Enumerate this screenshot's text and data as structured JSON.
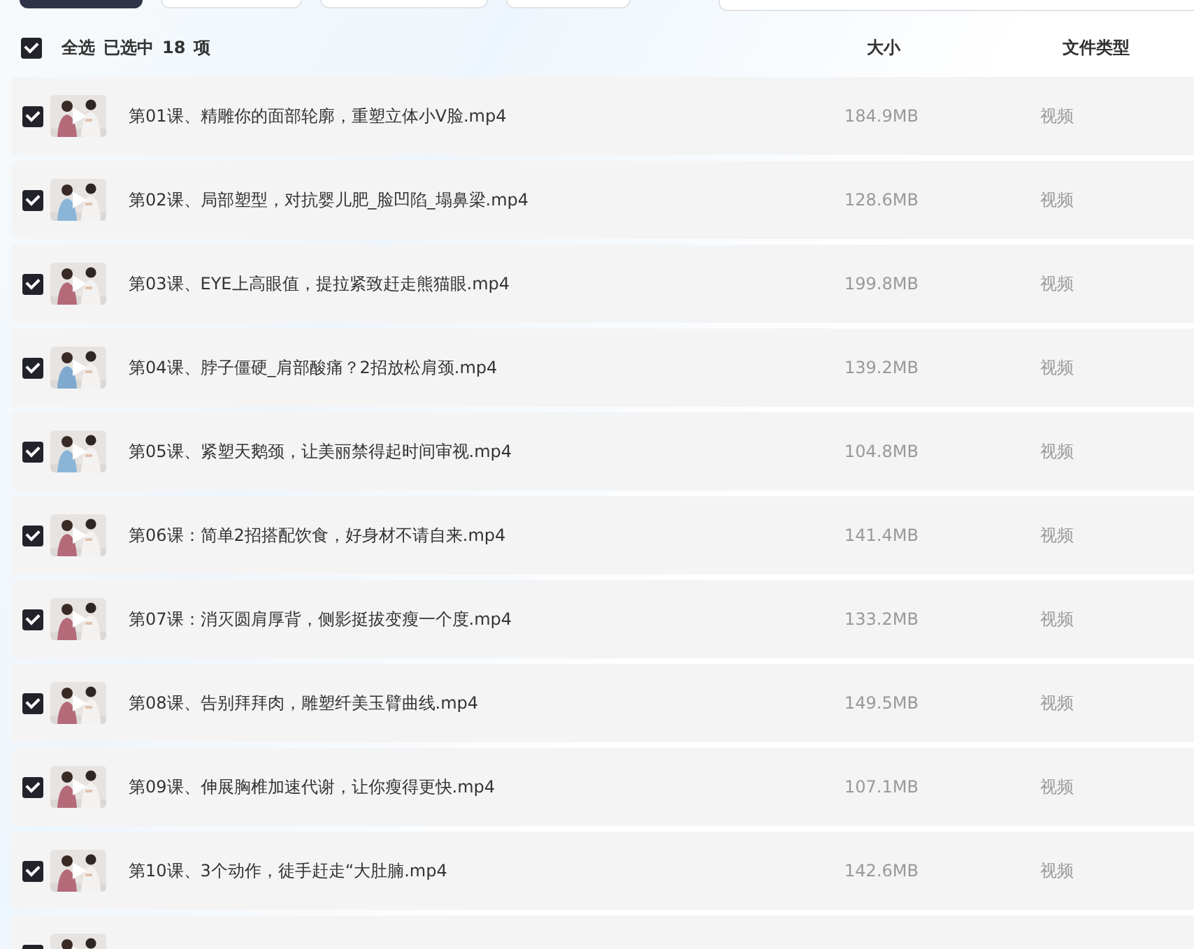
{
  "toolbar": {
    "buttons": [
      {
        "kind": "primary"
      },
      {
        "kind": "plain"
      },
      {
        "kind": "plain"
      },
      {
        "kind": "plain"
      }
    ],
    "search": {
      "kind": "field"
    }
  },
  "header": {
    "select_all": {
      "checked": true,
      "label": "全选"
    },
    "selected_label": "已选中",
    "selected_count": "18",
    "selected_unit": "项",
    "columns": [
      "大小",
      "文件类型"
    ]
  },
  "rows": [
    {
      "checked": true,
      "name": "第01课、精雕你的面部轮廓，重塑立体小V脸.mp4",
      "size": "184.9MB",
      "type": "视频"
    },
    {
      "checked": true,
      "name": "第02课、局部塑型，对抗婴儿肥_脸凹陷_塌鼻梁.mp4",
      "size": "128.6MB",
      "type": "视频"
    },
    {
      "checked": true,
      "name": "第03课、EYE上高眼值，提拉紧致赶走熊猫眼.mp4",
      "size": "199.8MB",
      "type": "视频"
    },
    {
      "checked": true,
      "name": "第04课、脖子僵硬_肩部酸痛？2招放松肩颈.mp4",
      "size": "139.2MB",
      "type": "视频"
    },
    {
      "checked": true,
      "name": "第05课、紧塑天鹅颈，让美丽禁得起时间审视.mp4",
      "size": "104.8MB",
      "type": "视频"
    },
    {
      "checked": true,
      "name": "第06课：简单2招搭配饮食，好身材不请自来.mp4",
      "size": "141.4MB",
      "type": "视频"
    },
    {
      "checked": true,
      "name": "第07课：消灭圆肩厚背，侧影挺拔变瘦一个度.mp4",
      "size": "133.2MB",
      "type": "视频"
    },
    {
      "checked": true,
      "name": "第08课、告别拜拜肉，雕塑纤美玉臂曲线.mp4",
      "size": "149.5MB",
      "type": "视频"
    },
    {
      "checked": true,
      "name": "第09课、伸展胸椎加速代谢，让你瘦得更快.mp4",
      "size": "107.1MB",
      "type": "视频"
    },
    {
      "checked": true,
      "name": "第10课、3个动作，徒手赶走“大肚腩.mp4",
      "size": "142.6MB",
      "type": "视频"
    },
    {
      "checked": true
    }
  ]
}
